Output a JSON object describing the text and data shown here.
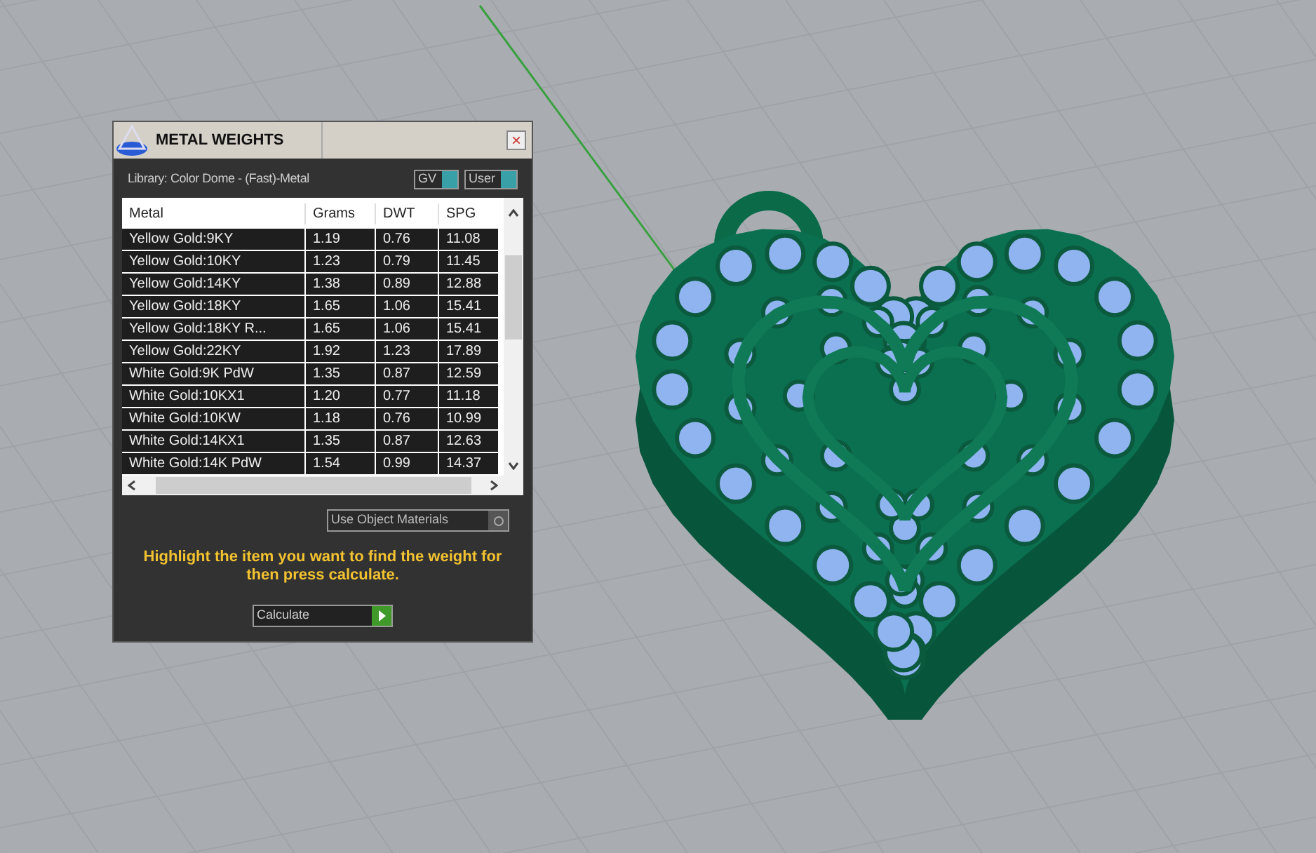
{
  "panel": {
    "title": "METAL WEIGHTS",
    "close": "×",
    "library": "Library: Color Dome - (Fast)-Metal",
    "toggles": [
      {
        "label": "GV",
        "on": true
      },
      {
        "label": "User",
        "on": true
      }
    ],
    "table": {
      "columns": [
        "Metal",
        "Grams",
        "DWT",
        "SPG"
      ],
      "rows": [
        [
          "Yellow Gold:9KY",
          "1.19",
          "0.76",
          "11.08"
        ],
        [
          "Yellow Gold:10KY",
          "1.23",
          "0.79",
          "11.45"
        ],
        [
          "Yellow Gold:14KY",
          "1.38",
          "0.89",
          "12.88"
        ],
        [
          "Yellow Gold:18KY",
          "1.65",
          "1.06",
          "15.41"
        ],
        [
          "Yellow Gold:18KY R...",
          "1.65",
          "1.06",
          "15.41"
        ],
        [
          "Yellow Gold:22KY",
          "1.92",
          "1.23",
          "17.89"
        ],
        [
          "White Gold:9K PdW",
          "1.35",
          "0.87",
          "12.59"
        ],
        [
          "White Gold:10KX1",
          "1.20",
          "0.77",
          "11.18"
        ],
        [
          "White Gold:10KW",
          "1.18",
          "0.76",
          "10.99"
        ],
        [
          "White Gold:14KX1",
          "1.35",
          "0.87",
          "12.63"
        ],
        [
          "White Gold:14K PdW",
          "1.54",
          "0.99",
          "14.37"
        ]
      ]
    },
    "use_object_materials": {
      "label": "Use Object Materials",
      "checked": false
    },
    "instruction": "Highlight the item you want to find the weight for then press calculate.",
    "calculate": "Calculate"
  }
}
